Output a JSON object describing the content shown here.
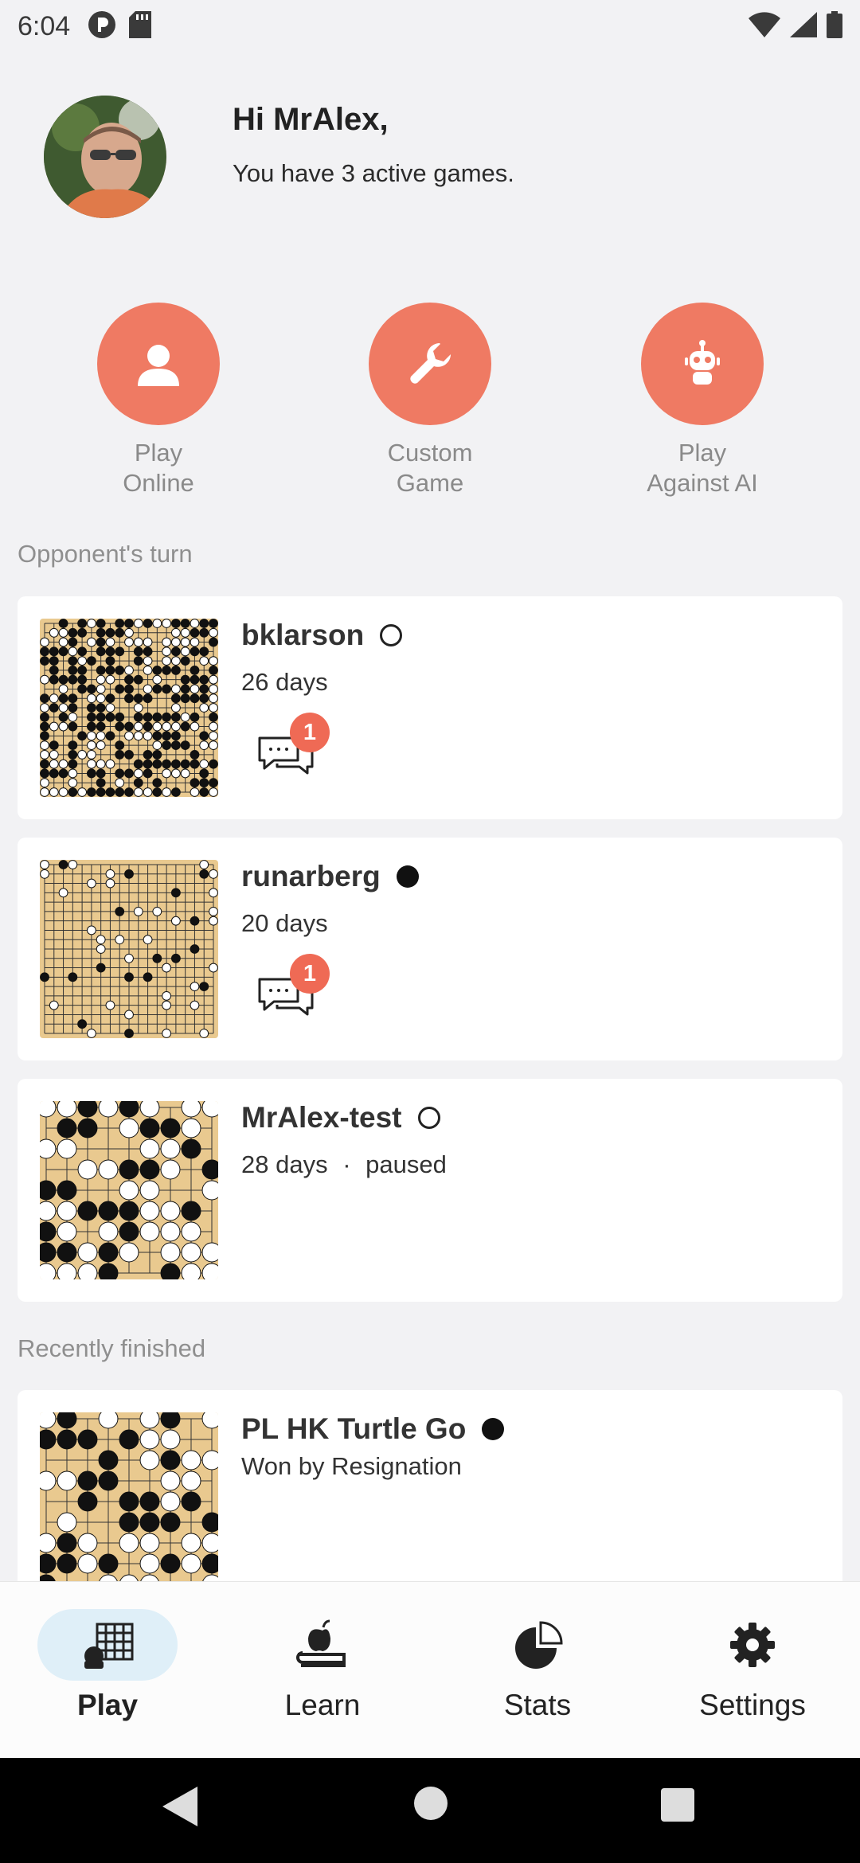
{
  "status_bar": {
    "time": "6:04"
  },
  "header": {
    "greeting": "Hi MrAlex,",
    "subtitle": "You have 3 active games."
  },
  "actions": [
    {
      "label": "Play\nOnline",
      "icon": "person-icon"
    },
    {
      "label": "Custom\nGame",
      "icon": "wrench-icon"
    },
    {
      "label": "Play\nAgainst AI",
      "icon": "robot-icon"
    }
  ],
  "sections": {
    "opponent_turn": "Opponent's turn",
    "recently_finished": "Recently finished"
  },
  "games": [
    {
      "opponent": "bklarson",
      "stone": "white",
      "time": "26 days",
      "unread": "1"
    },
    {
      "opponent": "runarberg",
      "stone": "black",
      "time": "20 days",
      "unread": "1"
    },
    {
      "opponent": "MrAlex-test",
      "stone": "white",
      "time": "28 days",
      "separator": "·",
      "state": "paused"
    }
  ],
  "finished": [
    {
      "opponent": "PL HK Turtle Go",
      "stone": "black",
      "result": "Won by Resignation"
    }
  ],
  "bottom_nav": [
    {
      "label": "Play",
      "active": true
    },
    {
      "label": "Learn",
      "active": false
    },
    {
      "label": "Stats",
      "active": false
    },
    {
      "label": "Settings",
      "active": false
    }
  ],
  "colors": {
    "accent": "#ef7a63",
    "badge": "#ef6a55",
    "board": "#e9c98f",
    "active_nav_bg": "#dfeff8"
  }
}
